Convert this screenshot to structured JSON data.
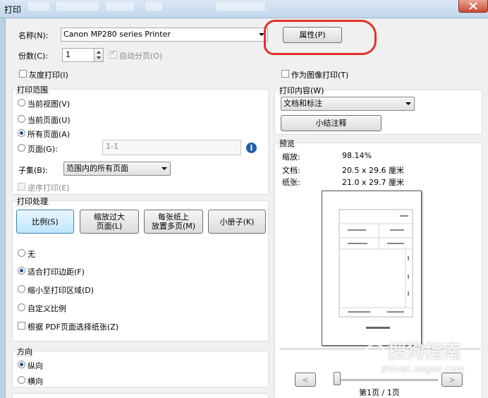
{
  "window": {
    "title": "打印"
  },
  "printer": {
    "label": "名称(N):",
    "value": "Canon MP280 series Printer",
    "properties_button": "属性(P)"
  },
  "copies": {
    "label": "份数(C):",
    "value": "1",
    "collate_label": "自动分页(O)"
  },
  "options": {
    "grayscale": "灰度打印(I)",
    "print_as_image": "作为图像打印(T)"
  },
  "range": {
    "group_label": "打印范围",
    "current_view": "当前视图(V)",
    "current_page": "当前页面(U)",
    "all_pages": "所有页面(A)",
    "pages": "页面(G):",
    "pages_value": "1-1",
    "subset_label": "子集(B):",
    "subset_value": "范围内的所有页面",
    "reverse": "逆序打印(E)"
  },
  "handling": {
    "group_label": "打印处理",
    "btn_scale": "比例(S)",
    "btn_fit_large_l1": "缩放过大",
    "btn_fit_large_l2": "页面(L)",
    "btn_multiple_l1": "每张纸上",
    "btn_multiple_l2": "放置多页(M)",
    "btn_booklet": "小册子(K)",
    "none": "无",
    "fit_margins": "适合打印边距(F)",
    "shrink": "缩小至打印区域(D)",
    "custom": "自定义比例",
    "choose_by_pdf": "根据 PDF页面选择纸张(Z)"
  },
  "orientation": {
    "group_label": "方向",
    "portrait": "纵向",
    "landscape": "横向"
  },
  "content": {
    "group_label": "打印内容(W)",
    "value": "文档和标注",
    "summarize_button": "小结注释"
  },
  "preview": {
    "group_label": "预览",
    "zoom_label": "缩放:",
    "zoom_value": "98.14%",
    "document_label": "文档:",
    "document_value": "20.5 x 29.6 厘米",
    "paper_label": "纸张:",
    "paper_value": "21.0 x 29.7 厘米",
    "page_indicator": "第1页 / 1页",
    "prev": "<",
    "next": ">"
  },
  "watermark": {
    "text": "搜狗指南",
    "url": "zhinan.sogou.com"
  },
  "icons": {
    "info": "info-icon",
    "close": "close-icon",
    "spinner": "spinner-arrows-icon"
  },
  "colors": {
    "highlight_circle": "#e0312a",
    "selected_button": "#bee6fd"
  }
}
